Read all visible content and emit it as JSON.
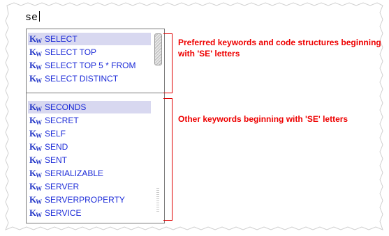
{
  "editor": {
    "typed_text": "se"
  },
  "icon": {
    "kw_main": "K",
    "kw_sub": "W",
    "color": "#2437c8"
  },
  "preferred_items": [
    {
      "label": "SELECT",
      "selected": true
    },
    {
      "label": "SELECT TOP",
      "selected": false
    },
    {
      "label": "SELECT TOP 5 * FROM",
      "selected": false
    },
    {
      "label": "SELECT DISTINCT",
      "selected": false
    }
  ],
  "other_items": [
    {
      "label": "SECONDS",
      "selected": true
    },
    {
      "label": "SECRET",
      "selected": false
    },
    {
      "label": "SELF",
      "selected": false
    },
    {
      "label": "SEND",
      "selected": false
    },
    {
      "label": "SENT",
      "selected": false
    },
    {
      "label": "SERIALIZABLE",
      "selected": false
    },
    {
      "label": "SERVER",
      "selected": false
    },
    {
      "label": "SERVERPROPERTY",
      "selected": false
    },
    {
      "label": "SERVICE",
      "selected": false
    }
  ],
  "annotations": {
    "preferred": "Preferred keywords and code structures beginning with 'SE' letters",
    "other": "Other keywords beginning with 'SE' letters"
  },
  "colors": {
    "annotation": "#ee0000",
    "item_text": "#1c2bd8",
    "selection": "#d8d8f0"
  }
}
